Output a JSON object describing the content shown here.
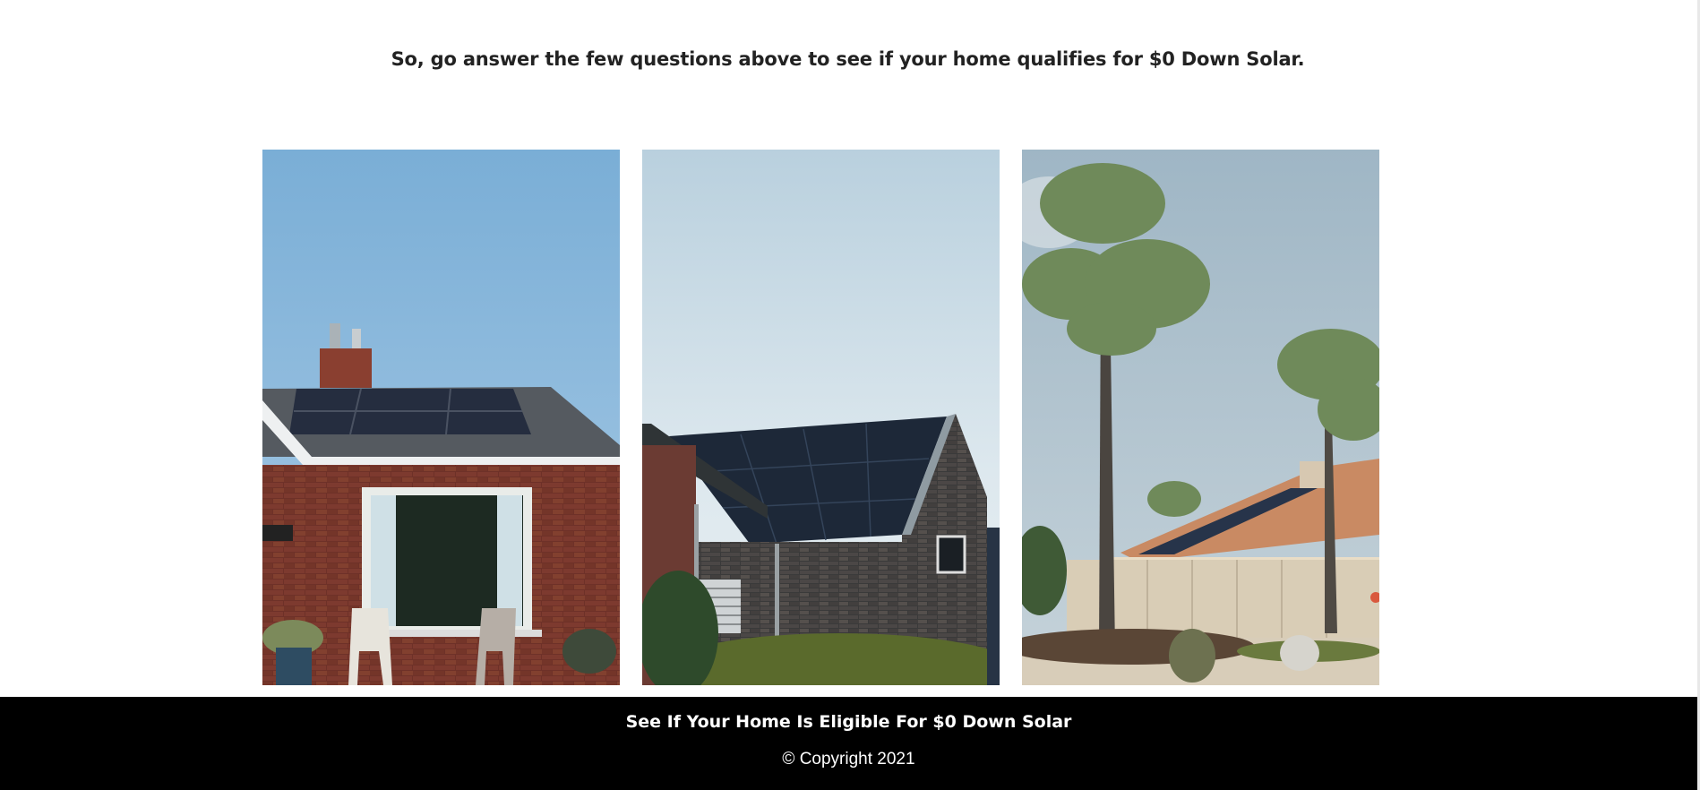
{
  "headline": "So, go answer the few questions above to see if your home qualifies for $0 Down Solar.",
  "gallery": [
    {
      "alt": "Brick house with solar panels on roof and patio chairs"
    },
    {
      "alt": "Dark brick house with full black solar panel roof"
    },
    {
      "alt": "House with tile roof, solar panels and tall palm trees"
    }
  ],
  "footer": {
    "cta": "See If Your Home Is Eligible For $0 Down Solar",
    "copyright": "© Copyright 2021"
  },
  "colors": {
    "footer_bg": "#000000",
    "text_dark": "#222222"
  }
}
